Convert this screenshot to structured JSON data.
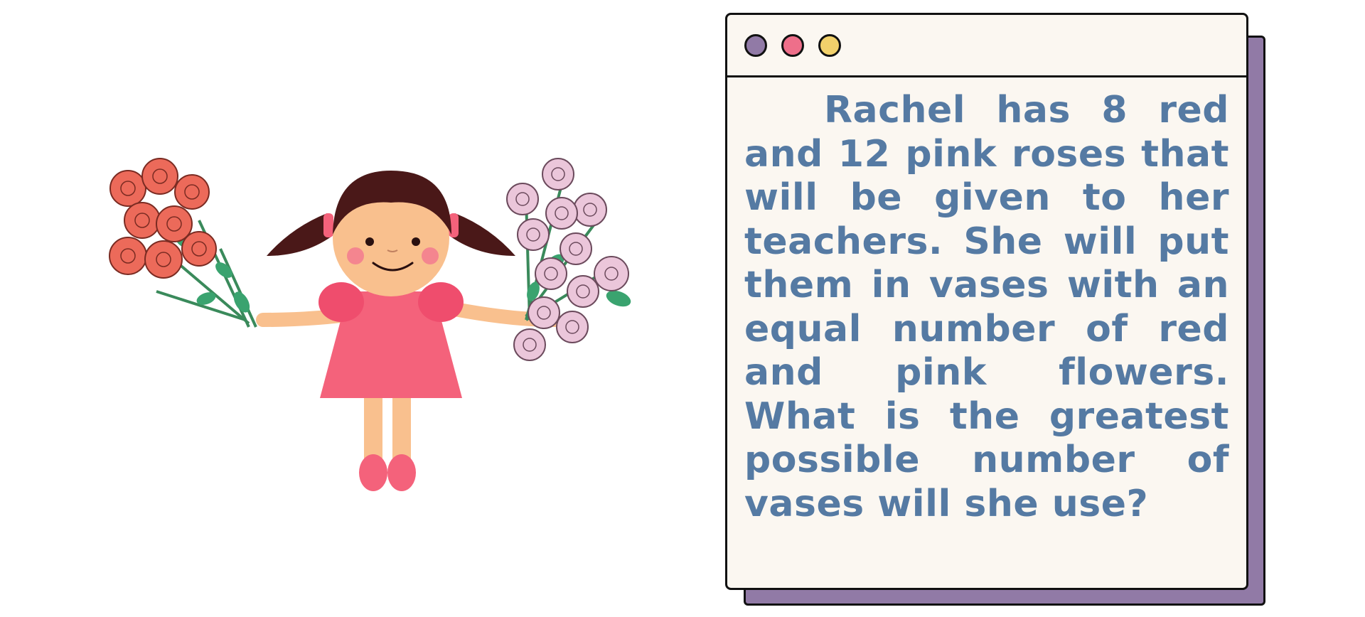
{
  "question": {
    "text": "Rachel has 8 red and 12 pink roses that will be given to her teachers. She will put them in vases with an equal number of red and pink flowers. What is the greatest possible number of vases will she use?"
  },
  "window": {
    "dots": [
      {
        "name": "purple-window-dot",
        "color": "#917aa6"
      },
      {
        "name": "pink-window-dot",
        "color": "#ee6f8a"
      },
      {
        "name": "yellow-window-dot",
        "color": "#f2d16b"
      }
    ]
  },
  "colors": {
    "text": "#557aa3",
    "shadow": "#917aa6",
    "panel": "#fbf7f1",
    "red_rose": "#ec6a5a",
    "pink_rose": "#ebc6da",
    "dress": "#f4627b",
    "hair": "#4a1818",
    "skin": "#f9c08e",
    "leaf": "#3aa36f"
  },
  "icons": {
    "illustration": "girl-holding-rose-bouquets"
  }
}
